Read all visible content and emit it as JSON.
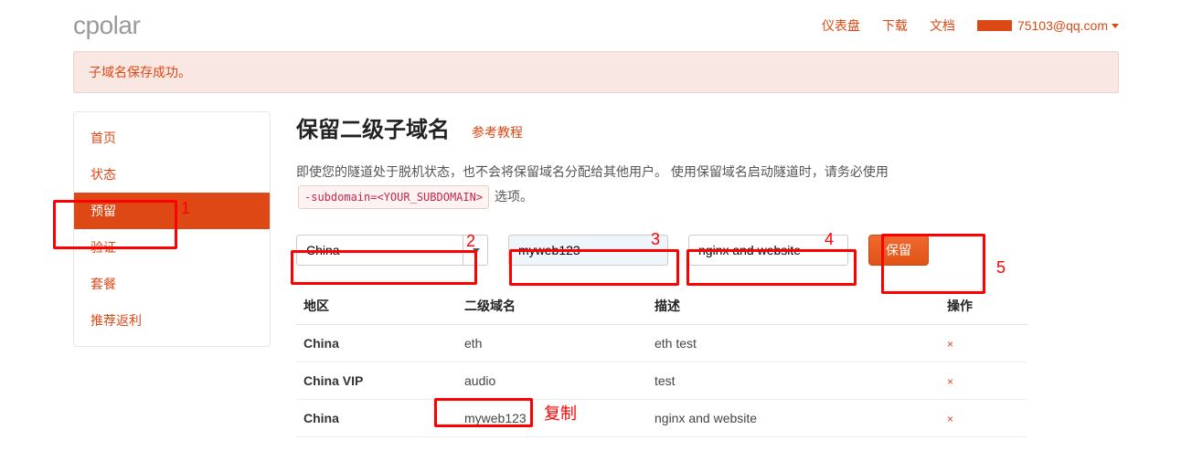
{
  "brand": "cpolar",
  "topnav": {
    "dashboard": "仪表盘",
    "download": "下载",
    "docs": "文档",
    "user_suffix": "75103@qq.com"
  },
  "alert": "子域名保存成功。",
  "sidebar": {
    "items": [
      {
        "label": "首页"
      },
      {
        "label": "状态"
      },
      {
        "label": "预留"
      },
      {
        "label": "验证"
      },
      {
        "label": "套餐"
      },
      {
        "label": "推荐返利"
      }
    ]
  },
  "main": {
    "title": "保留二级子域名",
    "help_link": "参考教程",
    "desc_prefix": "即使您的隧道处于脱机状态，也不会将保留域名分配给其他用户。 使用保留域名启动隧道时，请务必使用",
    "desc_code": "-subdomain=<YOUR_SUBDOMAIN>",
    "desc_suffix": "选项。",
    "form": {
      "region_selected": "China",
      "subdomain_value": "myweb123",
      "description_value": "nginx and website",
      "submit_label": "保留"
    },
    "table": {
      "headers": {
        "region": "地区",
        "subdomain": "二级域名",
        "description": "描述",
        "action": "操作"
      },
      "rows": [
        {
          "region": "China",
          "subdomain": "eth",
          "description": "eth test"
        },
        {
          "region": "China VIP",
          "subdomain": "audio",
          "description": "test"
        },
        {
          "region": "China",
          "subdomain": "myweb123",
          "description": "nginx and website"
        }
      ]
    }
  },
  "annotations": {
    "n1": "1",
    "n2": "2",
    "n3": "3",
    "n4": "4",
    "n5": "5",
    "copy": "复制"
  }
}
